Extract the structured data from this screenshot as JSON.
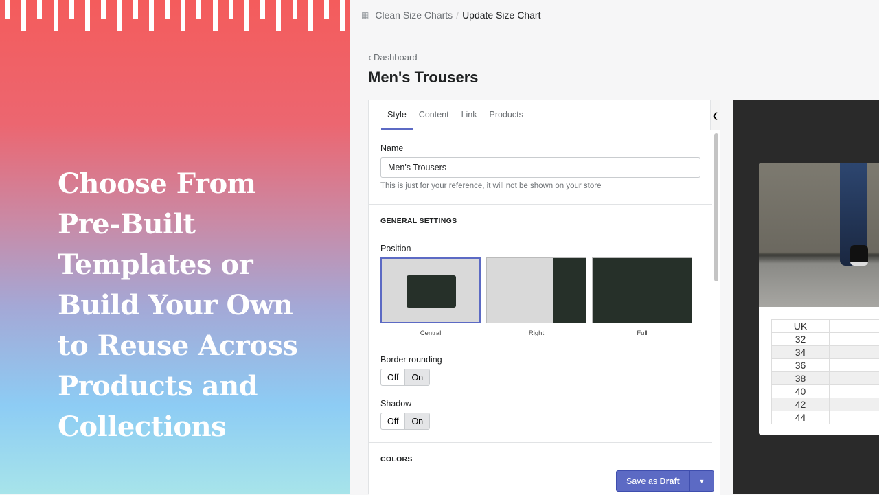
{
  "promo": {
    "headline": [
      "Choose From",
      "Pre-Built",
      "Templates or",
      "Build Your Own",
      "to Reuse Across",
      "Products and",
      "Collections"
    ],
    "gradient_colors": [
      "#f45c5c",
      "#c98aa6",
      "#8dccf4",
      "#a7e4ea"
    ]
  },
  "breadcrumb": {
    "app": "Clean Size Charts",
    "separator": "/",
    "page": "Update Size Chart"
  },
  "back_link": "Dashboard",
  "page_title": "Men's Trousers",
  "tabs": [
    "Style",
    "Content",
    "Link",
    "Products"
  ],
  "form": {
    "name_label": "Name",
    "name_value": "Men's Trousers",
    "name_help": "This is just for your reference, it will not be shown on your store",
    "general_settings": "GENERAL SETTINGS",
    "position_label": "Position",
    "positions": [
      "Central",
      "Right",
      "Full"
    ],
    "position_selected": "Central",
    "border_label": "Border rounding",
    "shadow_label": "Shadow",
    "off": "Off",
    "on": "On",
    "border_value": "On",
    "shadow_value": "On",
    "colors": "COLORS"
  },
  "save": {
    "prefix": "Save as ",
    "bold": "Draft"
  },
  "preview": {
    "header": "UK",
    "sizes": [
      "32",
      "34",
      "36",
      "38",
      "40",
      "42",
      "44"
    ]
  },
  "colors": {
    "accent": "#5c6ac4"
  }
}
